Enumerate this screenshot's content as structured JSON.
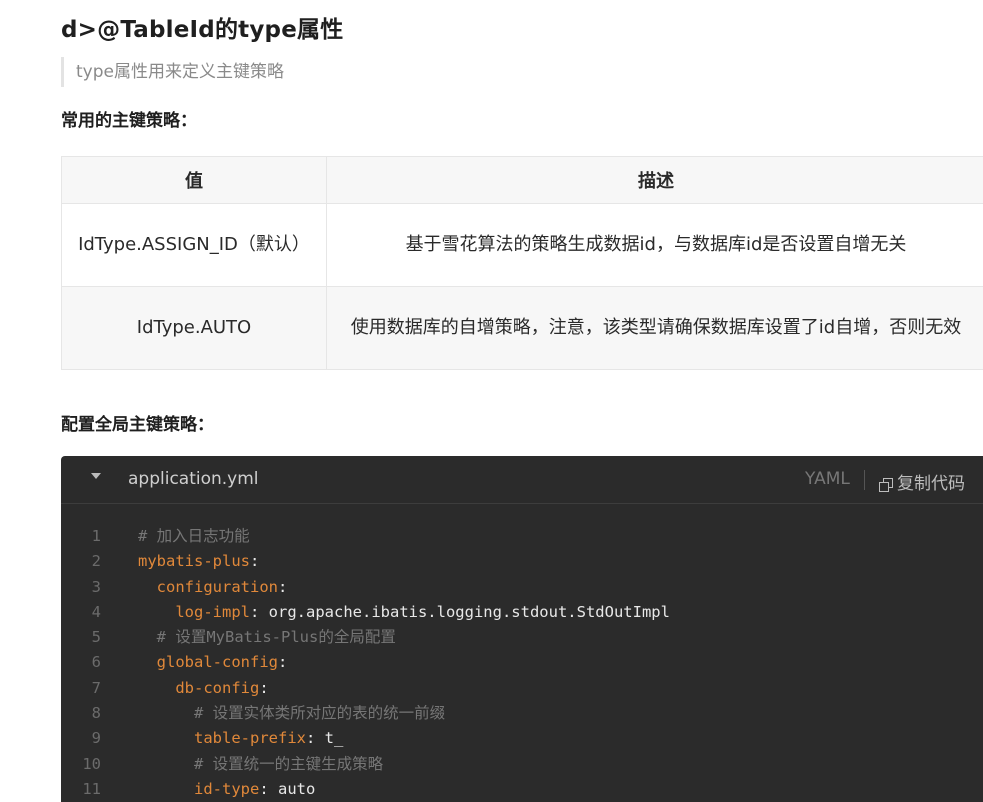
{
  "heading": "d>@TableId的type属性",
  "quote": "type属性用来定义主键策略",
  "section1_title": "常用的主键策略：",
  "table": {
    "headers": [
      "值",
      "描述"
    ],
    "rows": [
      {
        "value": "IdType.ASSIGN_ID（默认）",
        "description": "基于雪花算法的策略生成数据id，与数据库id是否设置自增无关"
      },
      {
        "value": "IdType.AUTO",
        "description": "使用数据库的自增策略，注意，该类型请确保数据库设置了id自增，否则无效"
      }
    ]
  },
  "section2_title": "配置全局主键策略：",
  "code_block": {
    "filename": "application.yml",
    "language": "YAML",
    "copy_label": "复制代码",
    "lines": [
      {
        "num": "1",
        "indent": "",
        "comment": "# 加入日志功能",
        "key": "",
        "value": ""
      },
      {
        "num": "2",
        "indent": "",
        "comment": "",
        "key": "mybatis-plus",
        "value": ""
      },
      {
        "num": "3",
        "indent": "  ",
        "comment": "",
        "key": "configuration",
        "value": ""
      },
      {
        "num": "4",
        "indent": "    ",
        "comment": "",
        "key": "log-impl",
        "value": "org.apache.ibatis.logging.stdout.StdOutImpl"
      },
      {
        "num": "5",
        "indent": "  ",
        "comment": "# 设置MyBatis-Plus的全局配置",
        "key": "",
        "value": ""
      },
      {
        "num": "6",
        "indent": "  ",
        "comment": "",
        "key": "global-config",
        "value": ""
      },
      {
        "num": "7",
        "indent": "    ",
        "comment": "",
        "key": "db-config",
        "value": ""
      },
      {
        "num": "8",
        "indent": "      ",
        "comment": "# 设置实体类所对应的表的统一前缀",
        "key": "",
        "value": ""
      },
      {
        "num": "9",
        "indent": "      ",
        "comment": "",
        "key": "table-prefix",
        "value": "t_"
      },
      {
        "num": "10",
        "indent": "      ",
        "comment": "# 设置统一的主键生成策略",
        "key": "",
        "value": ""
      },
      {
        "num": "11",
        "indent": "      ",
        "comment": "",
        "key": "id-type",
        "value": "auto"
      }
    ]
  },
  "colors": {
    "code_bg": "#2b2b2b",
    "yaml_key": "#e0883a",
    "comment": "#767676"
  }
}
